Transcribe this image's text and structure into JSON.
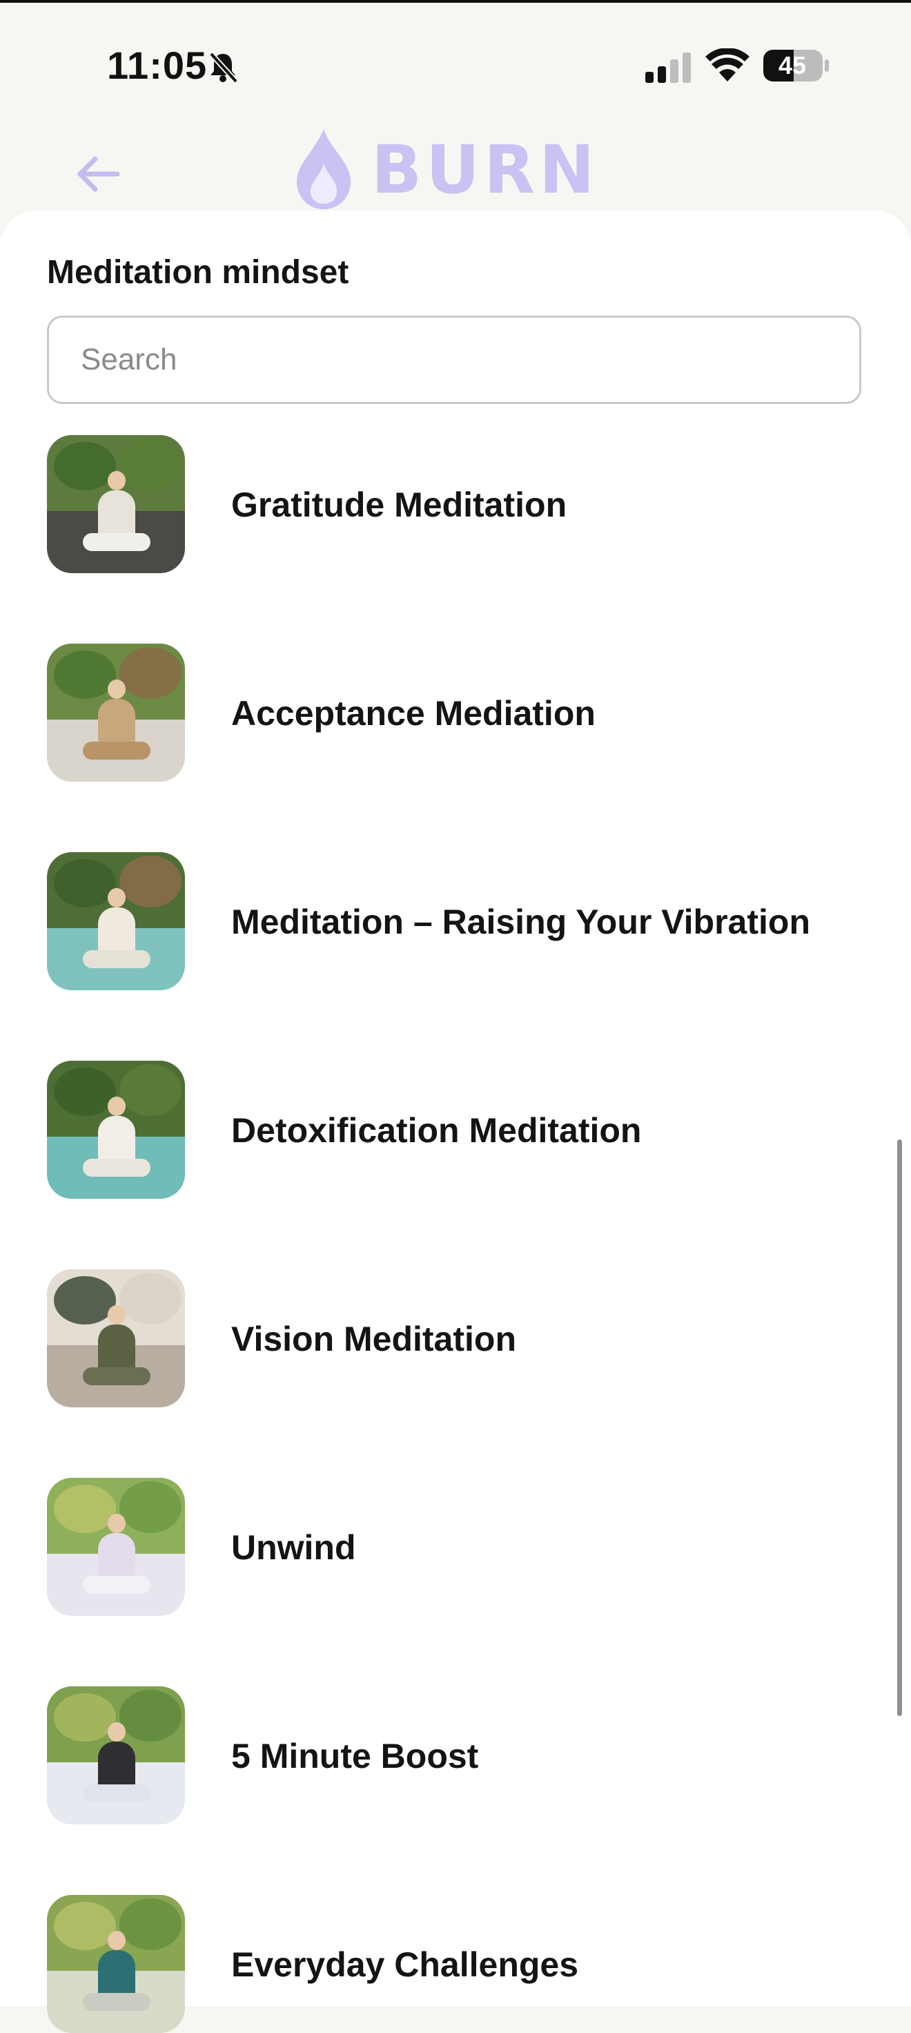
{
  "status_bar": {
    "time": "11:05",
    "battery": "45"
  },
  "header": {
    "logo_text": "BURN",
    "accent_color": "#c9c3f4"
  },
  "sheet": {
    "title": "Meditation mindset",
    "search_placeholder": "Search"
  },
  "items": [
    {
      "label": "Gratitude Meditation"
    },
    {
      "label": "Acceptance Mediation"
    },
    {
      "label": "Meditation –  Raising Your Vibration"
    },
    {
      "label": "Detoxification Meditation"
    },
    {
      "label": "Vision Meditation"
    },
    {
      "label": "Unwind"
    },
    {
      "label": "5 Minute Boost"
    },
    {
      "label": "Everyday Challenges"
    }
  ]
}
